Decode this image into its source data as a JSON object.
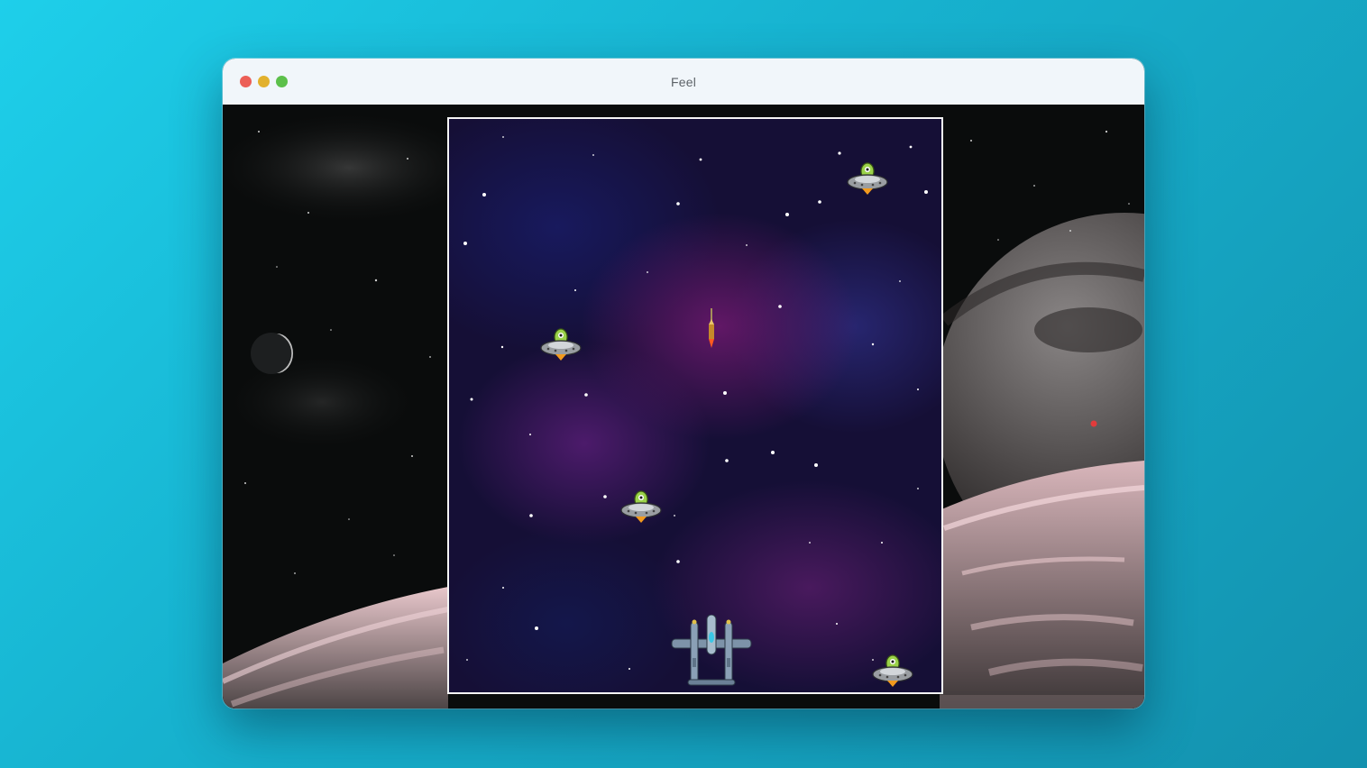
{
  "window": {
    "title": "Feel"
  },
  "game": {
    "player": {
      "icon": "fighter-plane-icon"
    },
    "enemies": [
      {
        "icon": "alien-ufo-icon"
      },
      {
        "icon": "alien-ufo-icon"
      },
      {
        "icon": "alien-ufo-icon"
      },
      {
        "icon": "alien-ufo-icon"
      }
    ],
    "projectile": {
      "icon": "missile-icon"
    }
  },
  "colors": {
    "traffic_close": "#ec5f57",
    "traffic_minimize": "#e2b12d",
    "traffic_maximize": "#5cc04a",
    "game_border": "#f4f4f4"
  }
}
